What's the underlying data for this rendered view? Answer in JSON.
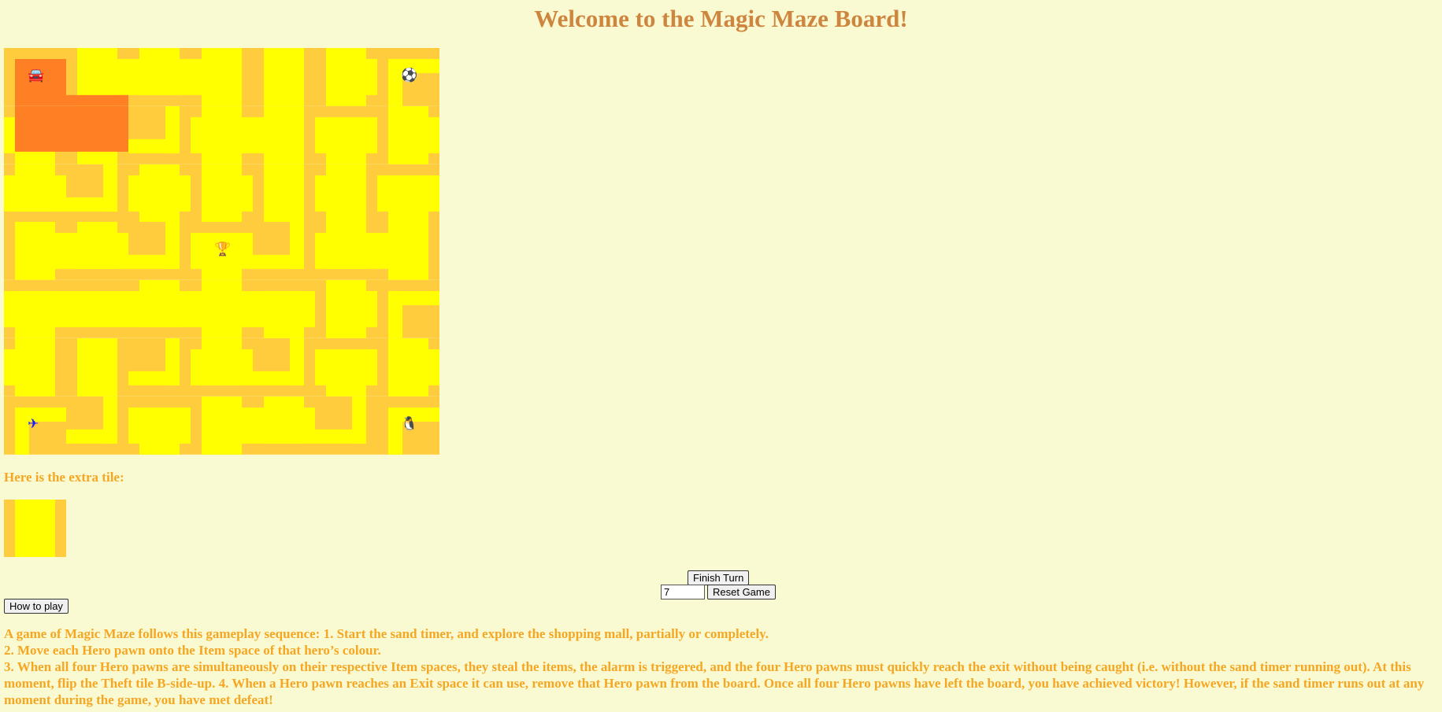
{
  "title": "Welcome to the Magic Maze Board!",
  "colors": {
    "wall": "#ffcc3e",
    "path": "#ffff00",
    "highlight": "#ff7f24",
    "pawn": "#1a1aff",
    "text": "#f5a623",
    "title": "#cd853f",
    "background": "#fafad2"
  },
  "board": {
    "tiles": [
      [
        "corner-start",
        "t",
        "t",
        "t",
        "straight",
        "t",
        "corner"
      ],
      [
        "t",
        "straight",
        "corner",
        "cross",
        "t",
        "t",
        "t"
      ],
      [
        "t",
        "corner",
        "cross",
        "t",
        "straight",
        "t",
        "t"
      ],
      [
        "t",
        "t",
        "corner-trophy",
        "t",
        "corner",
        "t",
        "t"
      ],
      [
        "t",
        "straight",
        "t",
        "cross",
        "t",
        "t",
        "corner"
      ],
      [
        "t",
        "straight",
        "corner",
        "t",
        "corner",
        "t",
        "t"
      ],
      [
        "corner-jet",
        "corner",
        "t",
        "t",
        "t",
        "corner",
        "corner-penguin"
      ]
    ],
    "pawns": [
      {
        "name": "car",
        "icon": "car-icon",
        "glyph": "🚘",
        "row": 0,
        "col": 0
      },
      {
        "name": "ball",
        "icon": "soccer-ball-icon",
        "glyph": "⚽",
        "row": 0,
        "col": 6
      },
      {
        "name": "trophy",
        "icon": "trophy-icon",
        "glyph": "🏆",
        "row": 3,
        "col": 3
      },
      {
        "name": "jet",
        "icon": "jet-icon",
        "glyph": "✈",
        "row": 6,
        "col": 0
      },
      {
        "name": "penguin",
        "icon": "penguin-icon",
        "glyph": "🐧",
        "row": 6,
        "col": 6
      }
    ]
  },
  "extra_tile": {
    "label": "Here is the extra tile:",
    "type": "straight"
  },
  "controls": {
    "finish_turn": "Finish Turn",
    "turns_value": "7",
    "reset_game": "Reset Game",
    "how_to_play": "How to play"
  },
  "instructions": {
    "line1": "A game of Magic Maze follows this gameplay sequence: 1. Start the sand timer, and explore the shopping mall, partially or completely.",
    "line2": "2. Move each Hero pawn onto the Item space of that hero’s colour.",
    "line3": "3. When all four Hero pawns are simultaneously on their respective Item spaces, they steal the items, the alarm is triggered, and the four Hero pawns must quickly reach the exit without being caught (i.e. without the sand timer running out). At this moment, flip the Theft tile B-side-up. 4. When a Hero pawn reaches an Exit space it can use, remove that Hero pawn from the board. Once all four Hero pawns have left the board, you have achieved victory! However, if the sand timer runs out at any moment during the game, you have met defeat!"
  }
}
